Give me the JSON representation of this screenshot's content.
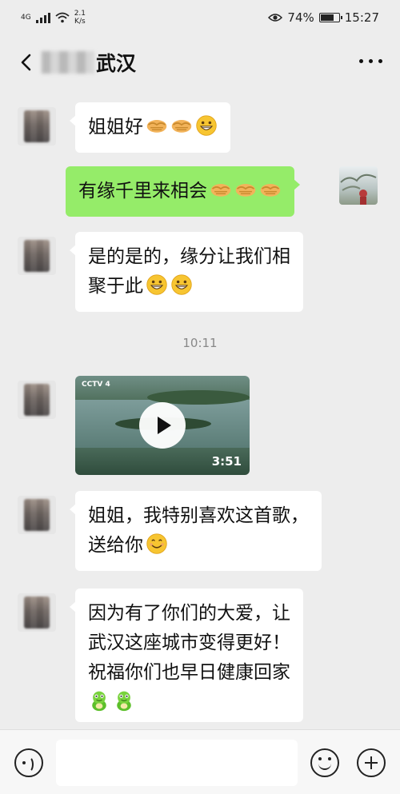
{
  "status_bar": {
    "network": "4G",
    "speed_value": "2.1",
    "speed_unit": "K/s",
    "battery": "74%",
    "time": "15:27"
  },
  "header": {
    "title": "武汉"
  },
  "messages": {
    "m1": "姐姐好",
    "m2": "有缘千里来相会",
    "m3_line1": "是的是的，缘分让我们相",
    "m3_line2": "聚于此",
    "timestamp": "10:11",
    "video": {
      "channel_logo": "CCTV 4",
      "duration": "3:51"
    },
    "m5_line1": "姐姐，我特别喜欢这首歌，",
    "m5_line2": "送给你",
    "m6_line1": "因为有了你们的大爱，让",
    "m6_line2": "武汉这座城市变得更好！",
    "m6_line3": "祝福你们也早日健康回家"
  },
  "icons": {
    "handshake": "handshake-emoji",
    "grin": "grin-emoji",
    "smile": "smile-emoji",
    "frog": "frog-emoji"
  },
  "colors": {
    "outgoing_bubble": "#95ec69",
    "incoming_bubble": "#ffffff",
    "background": "#ededed"
  }
}
